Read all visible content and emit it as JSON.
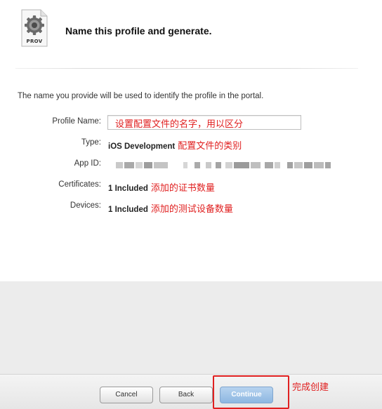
{
  "header": {
    "icon_label": "PROV",
    "title": "Name this profile and generate."
  },
  "intro": "The name you provide will be used to identify the profile in the portal.",
  "form": {
    "profile_name": {
      "label": "Profile Name:",
      "value": "设置配置文件的名字，用以区分"
    },
    "type": {
      "label": "Type:",
      "value": "iOS Development",
      "annotation": "配置文件的类别"
    },
    "app_id": {
      "label": "App ID:"
    },
    "certificates": {
      "label": "Certificates:",
      "value": "1 Included",
      "annotation": "添加的证书数量"
    },
    "devices": {
      "label": "Devices:",
      "value": "1 Included",
      "annotation": "添加的测试设备数量"
    }
  },
  "buttons": {
    "cancel": "Cancel",
    "back": "Back",
    "continue": "Continue"
  },
  "highlight_annotation": "完成创建",
  "colors": {
    "annotation_red": "#e02020",
    "continue_blue": "#8db7e1"
  }
}
